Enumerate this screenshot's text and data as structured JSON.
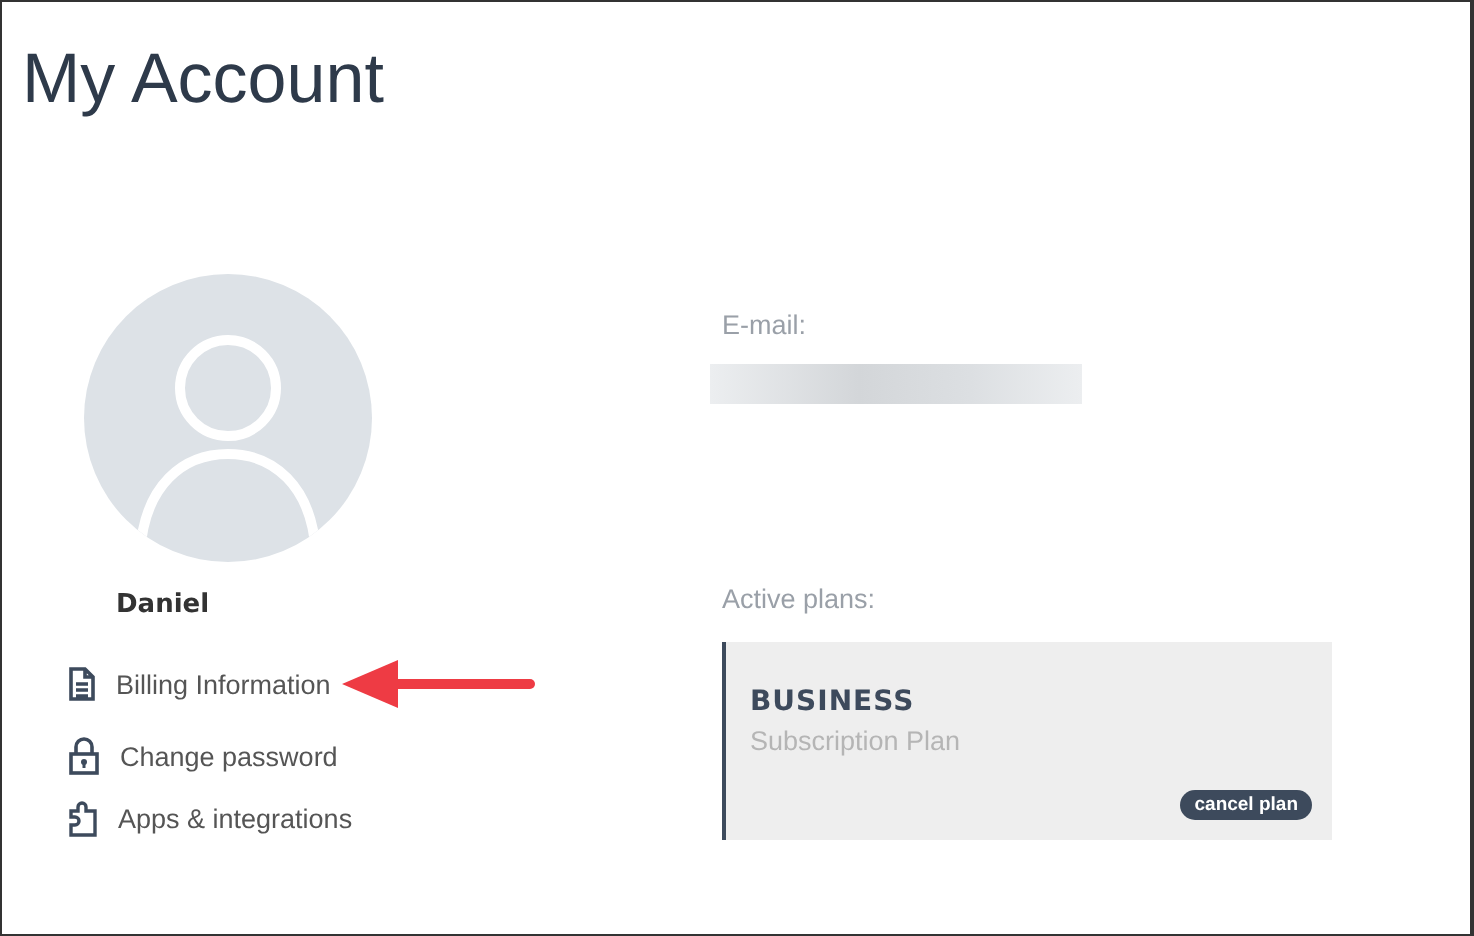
{
  "page": {
    "title": "My Account"
  },
  "profile": {
    "name": "Daniel"
  },
  "menu": [
    {
      "label": "Billing Information",
      "kind": "document",
      "highlighted": true
    },
    {
      "label": "Change password",
      "kind": "lock",
      "highlighted": false
    },
    {
      "label": "Apps & integrations",
      "kind": "puzzle",
      "highlighted": false
    }
  ],
  "email": {
    "label": "E-mail:",
    "value_redacted": true
  },
  "plans": {
    "label": "Active plans:",
    "items": [
      {
        "name": "BUSINESS",
        "type": "Subscription Plan",
        "action": "cancel plan"
      }
    ]
  }
}
